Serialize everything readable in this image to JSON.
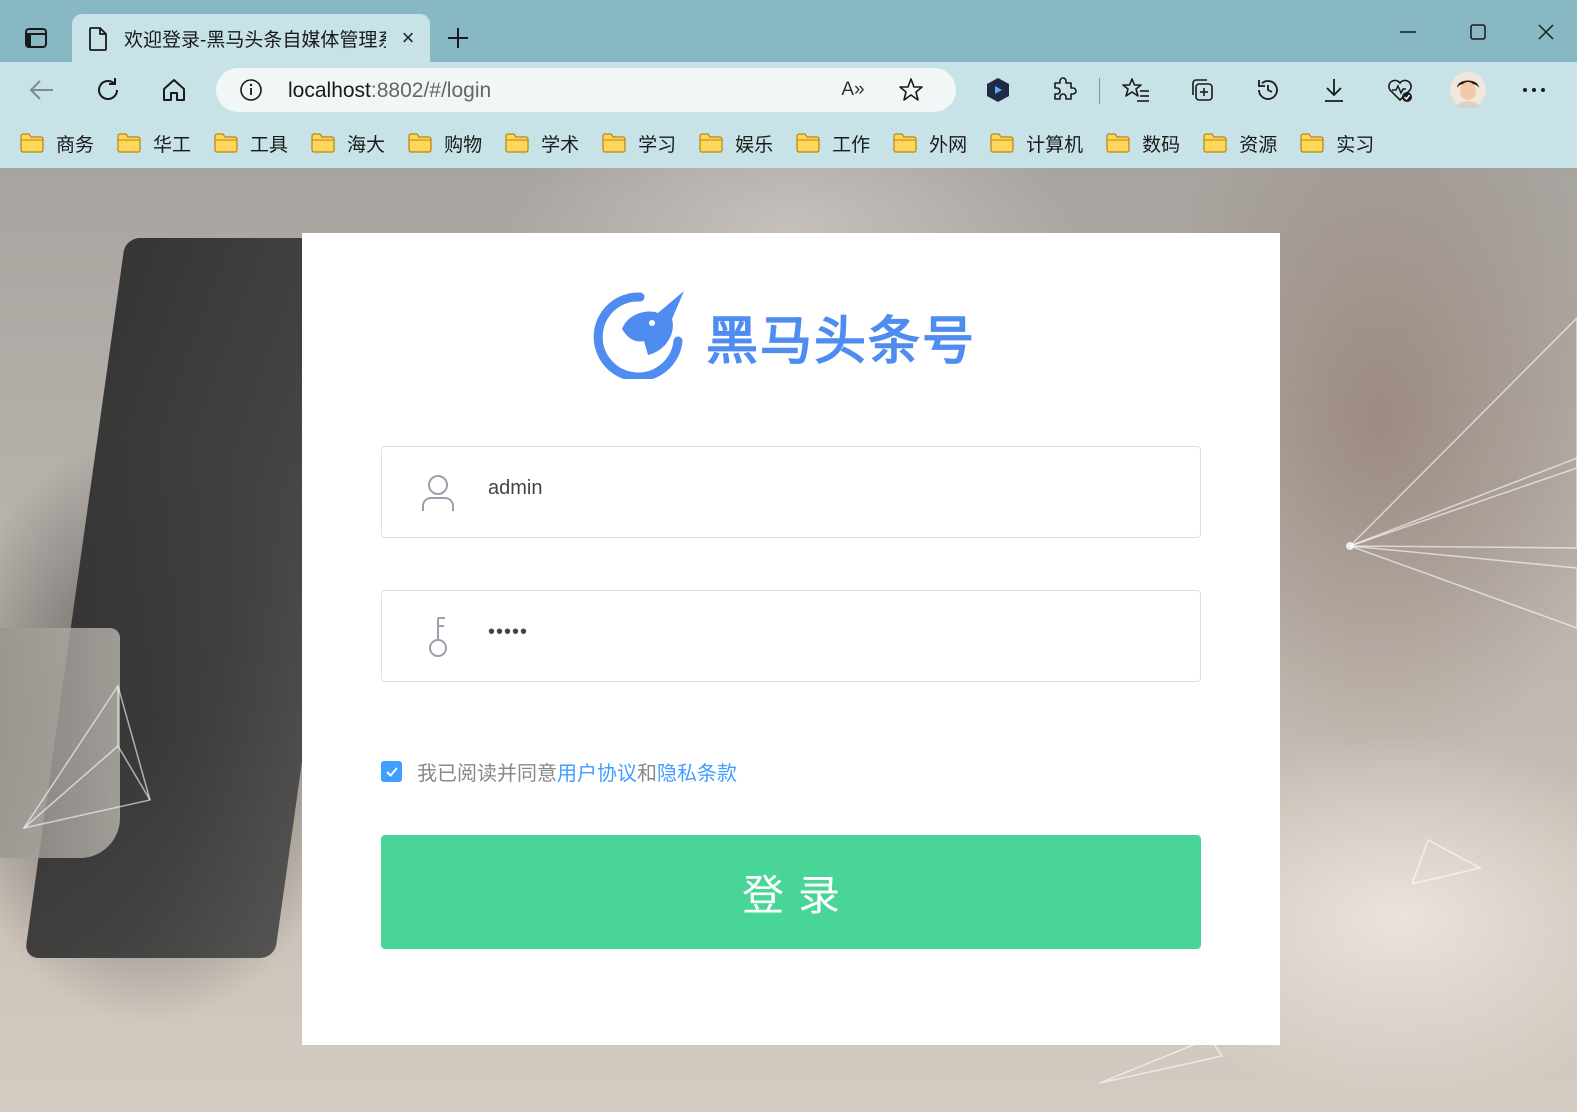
{
  "browser": {
    "tab_title": "欢迎登录-黑马头条自媒体管理系",
    "tab_close": "×",
    "new_tab": "+",
    "url_host": "localhost",
    "url_rest": ":8802/#/login",
    "read_aloud_label": "A»"
  },
  "bookmarks": [
    "商务",
    "华工",
    "工具",
    "海大",
    "购物",
    "学术",
    "学习",
    "娱乐",
    "工作",
    "外网",
    "计算机",
    "数码",
    "资源",
    "实习"
  ],
  "login": {
    "brand": "黑马头条号",
    "username_value": "admin",
    "password_mask": "•••••",
    "agree_checked": true,
    "agree_text": "我已阅读并同意 ",
    "agree_link1": "用户协议",
    "agree_and": "和 ",
    "agree_link2": "隐私条款",
    "submit_label": "登录"
  },
  "colors": {
    "accent_blue": "#409eff",
    "brand_blue": "#4e8cf0",
    "submit_green": "#48d597",
    "browser_frame": "#87b8c3",
    "browser_toolbar": "#c8e3e8"
  }
}
